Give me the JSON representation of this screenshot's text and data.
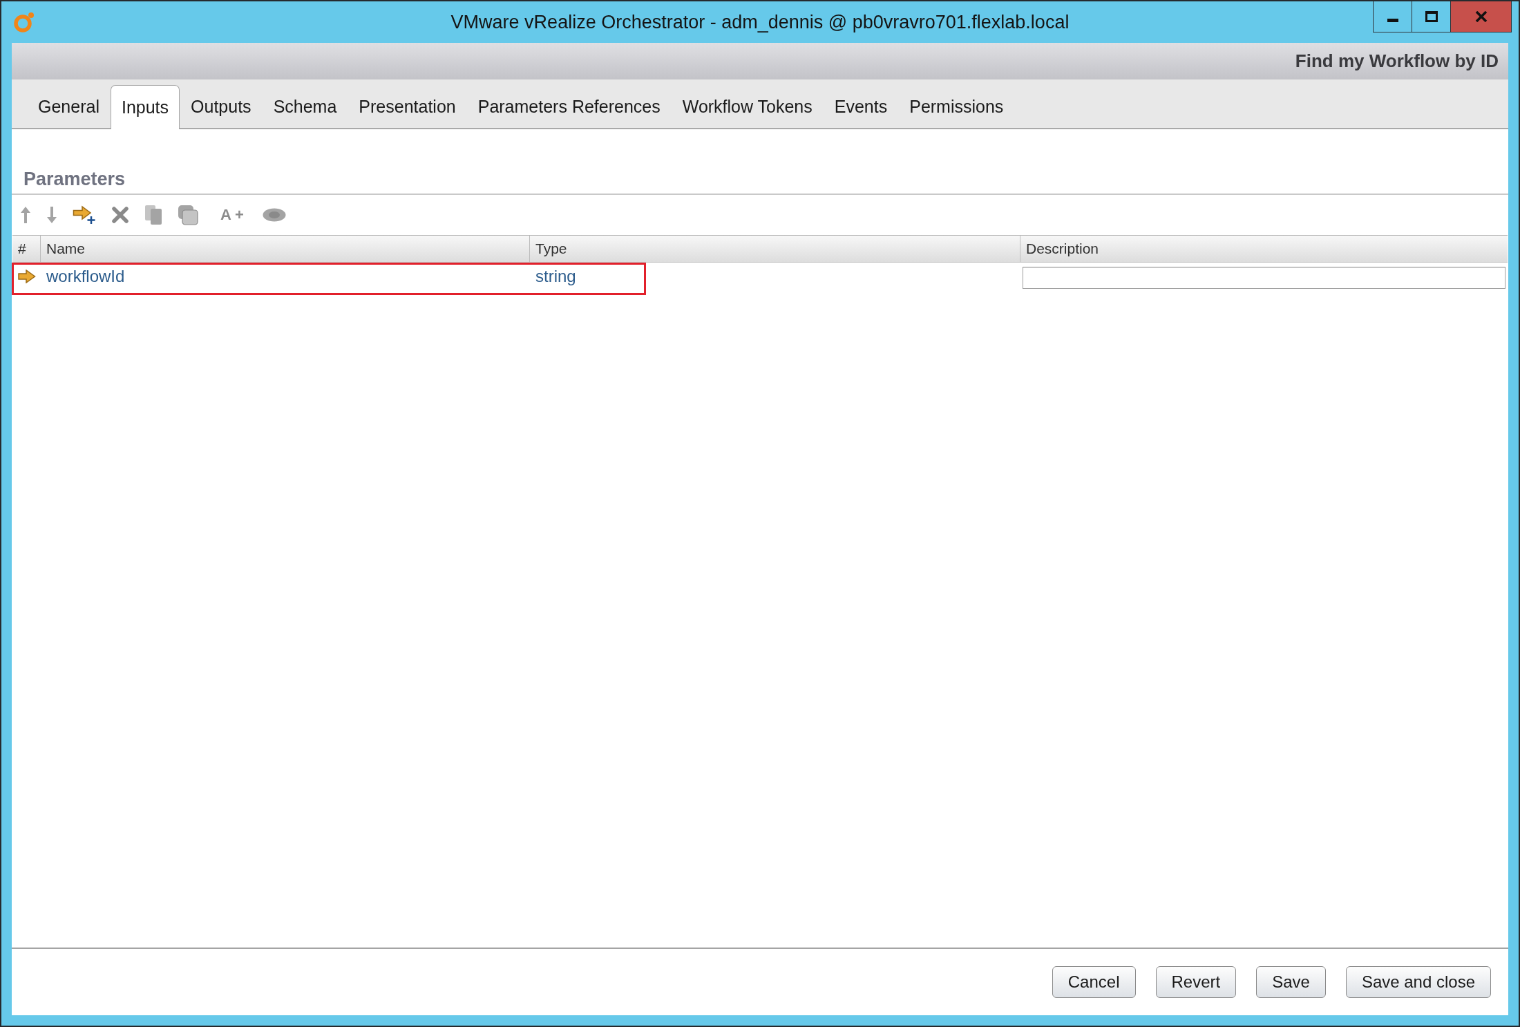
{
  "window": {
    "title": "VMware vRealize Orchestrator - adm_dennis @ pb0vravro701.flexlab.local"
  },
  "header": {
    "title": "Find my Workflow by ID"
  },
  "tabs": [
    {
      "label": "General",
      "selected": false
    },
    {
      "label": "Inputs",
      "selected": true
    },
    {
      "label": "Outputs",
      "selected": false
    },
    {
      "label": "Schema",
      "selected": false
    },
    {
      "label": "Presentation",
      "selected": false
    },
    {
      "label": "Parameters References",
      "selected": false
    },
    {
      "label": "Workflow Tokens",
      "selected": false
    },
    {
      "label": "Events",
      "selected": false
    },
    {
      "label": "Permissions",
      "selected": false
    }
  ],
  "parameters": {
    "title": "Parameters",
    "toolbar": [
      {
        "kind": "up",
        "disabled": true
      },
      {
        "kind": "down",
        "disabled": true
      },
      {
        "kind": "add",
        "disabled": false
      },
      {
        "kind": "delete",
        "disabled": true
      },
      {
        "kind": "copy",
        "disabled": true
      },
      {
        "kind": "paste",
        "disabled": true
      },
      {
        "kind": "attribute",
        "label": "A+",
        "disabled": true
      },
      {
        "kind": "visibility",
        "disabled": true
      }
    ],
    "table": {
      "columns": [
        "#",
        "Name",
        "Type",
        "Description"
      ],
      "rows": [
        {
          "name": "workflowId",
          "type": "string",
          "highlighted": true
        }
      ]
    }
  },
  "buttons": [
    "Cancel",
    "Revert",
    "Save",
    "Save and close"
  ]
}
